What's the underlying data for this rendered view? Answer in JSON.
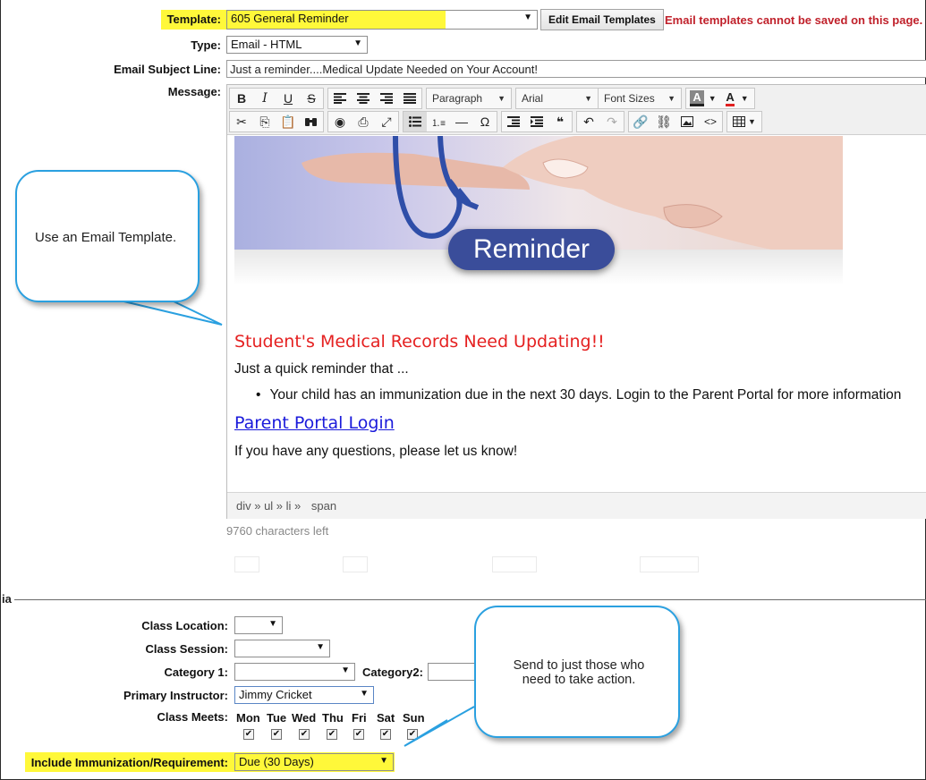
{
  "template": {
    "label": "Template:",
    "value": "605 General Reminder",
    "edit_button": "Edit Email Templates",
    "warning": "Email templates cannot be saved on this page. Cli"
  },
  "type": {
    "label": "Type:",
    "value": "Email - HTML"
  },
  "subject": {
    "label": "Email Subject Line:",
    "value": "Just a reminder....Medical Update Needed on Your Account!"
  },
  "message": {
    "label": "Message:"
  },
  "toolbar": {
    "paragraph": "Paragraph",
    "font": "Arial",
    "font_sizes": "Font Sizes",
    "letter_a": "A",
    "row1_icons": [
      "bold-icon",
      "italic-icon",
      "underline-icon",
      "strikethrough-icon",
      "align-left-icon",
      "align-center-icon",
      "align-right-icon",
      "align-justify-icon"
    ],
    "row2_icons": [
      "cut-icon",
      "copy-icon",
      "paste-icon",
      "find-icon",
      "preview-icon",
      "print-icon",
      "fullscreen-icon",
      "bullet-list-icon",
      "numbered-list-icon",
      "horizontal-rule-icon",
      "special-char-icon",
      "outdent-icon",
      "indent-icon",
      "blockquote-icon",
      "undo-icon",
      "redo-icon",
      "link-icon",
      "unlink-icon",
      "image-icon",
      "code-icon",
      "table-icon"
    ],
    "bold": "B",
    "italic": "I",
    "underline": "U",
    "strike": "S",
    "omega": "Ω",
    "quote": "❝",
    "code": "<>"
  },
  "email_content": {
    "banner_text": "Reminder",
    "heading": "Student's Medical Records Need Updating!!",
    "intro": "Just a quick reminder that ...",
    "bullet": "Your child has an immunization due in the next 30 days. Login to the Parent Portal for more information",
    "link": "Parent Portal Login",
    "closing": "If you have any questions, please let us know!"
  },
  "status": {
    "path": "div » ul » li »",
    "current": "span",
    "chars_left": "9760 characters left"
  },
  "criteria": {
    "legend_fragment": "ia",
    "class_location": {
      "label": "Class Location:",
      "value": ""
    },
    "class_session": {
      "label": "Class Session:",
      "value": ""
    },
    "category1": {
      "label": "Category 1:",
      "value": ""
    },
    "category2": {
      "label": "Category2:",
      "value": ""
    },
    "primary_instructor": {
      "label": "Primary Instructor:",
      "value": "Jimmy Cricket"
    },
    "class_meets": {
      "label": "Class Meets:",
      "days": [
        "Mon",
        "Tue",
        "Wed",
        "Thu",
        "Fri",
        "Sat",
        "Sun"
      ]
    },
    "immunization": {
      "label": "Include Immunization/Requirement:",
      "value": "Due (30 Days)"
    }
  },
  "callouts": {
    "template": "Use an Email Template.",
    "send": "Send to just those who need to take action."
  },
  "colors": {
    "highlight": "#fff83a",
    "warning": "#c0212b",
    "callout_border": "#2aa0e0",
    "heading_red": "#e52121",
    "link_blue": "#1a1adb",
    "pill": "#3a4d9a"
  }
}
